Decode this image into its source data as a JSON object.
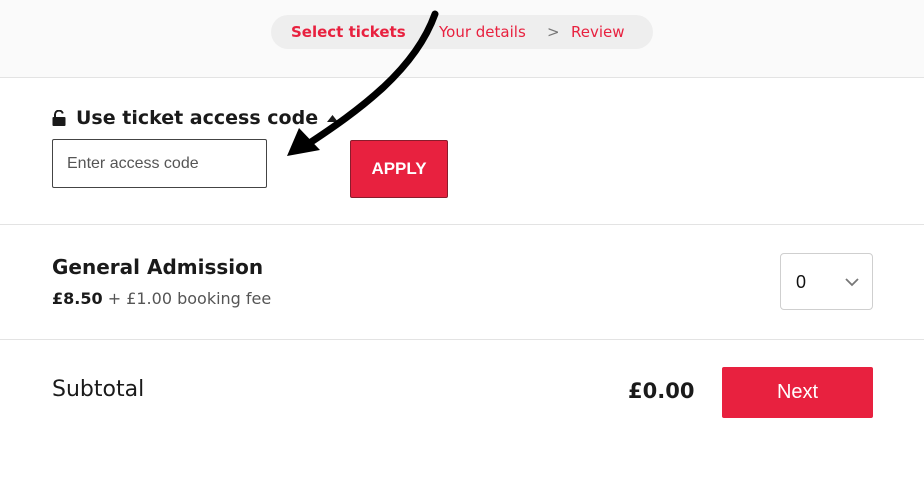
{
  "stepper": {
    "steps": [
      {
        "label": "Select tickets",
        "state": "active"
      },
      {
        "label": "Your details",
        "state": "upcoming"
      },
      {
        "label": "Review",
        "state": "upcoming"
      }
    ],
    "separator": ">"
  },
  "access_code": {
    "label": "Use ticket access code",
    "input_placeholder": "Enter access code",
    "input_value": "",
    "apply_label": "APPLY",
    "lock_icon": "unlocked-padlock-icon",
    "toggle_icon": "caret-up-icon"
  },
  "ticket": {
    "name": "General Admission",
    "price": "£8.50",
    "fee_text": "+ £1.00 booking fee",
    "quantity_selected": "0",
    "quantity_icon": "chevron-down-icon"
  },
  "summary": {
    "subtotal_label": "Subtotal",
    "subtotal_amount": "£0.00",
    "next_label": "Next"
  },
  "colors": {
    "accent": "#e8213f",
    "text": "#1a1a1a",
    "muted": "#555555",
    "divider": "#e3e3e3",
    "topbar_bg": "#fafafa",
    "stepper_bg": "#eeeeee"
  }
}
